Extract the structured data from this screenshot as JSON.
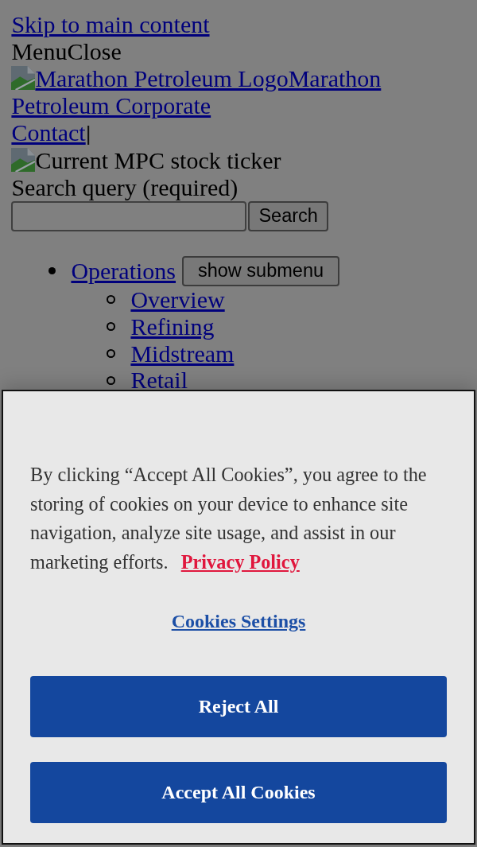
{
  "skip_link": "Skip to main content",
  "menu_toggle": {
    "menu_label": "Menu",
    "close_label": "Close"
  },
  "logo_link": {
    "image_alt": "Marathon Petroleum Logo",
    "label": "Marathon Petroleum Corporate"
  },
  "contact_link": "Contact",
  "separator": "|",
  "stock_ticker": {
    "image_alt": "Current MPC stock ticker"
  },
  "search": {
    "label": "Search query (required)",
    "button": "Search"
  },
  "nav": [
    {
      "label": "Operations",
      "submenu_button": "show submenu",
      "children": [
        {
          "label": "Overview"
        },
        {
          "label": "Refining"
        },
        {
          "label": "Midstream"
        },
        {
          "label": "Retail"
        }
      ]
    }
  ],
  "cookie_banner": {
    "message": "By clicking “Accept All Cookies”, you agree to the storing of cookies on your device to enhance site navigation, analyze site usage, and assist in our marketing efforts.",
    "privacy_link": "Privacy Policy",
    "settings_link": "Cookies Settings",
    "buttons": [
      {
        "label": "Reject All"
      },
      {
        "label": "Accept All Cookies"
      }
    ]
  }
}
